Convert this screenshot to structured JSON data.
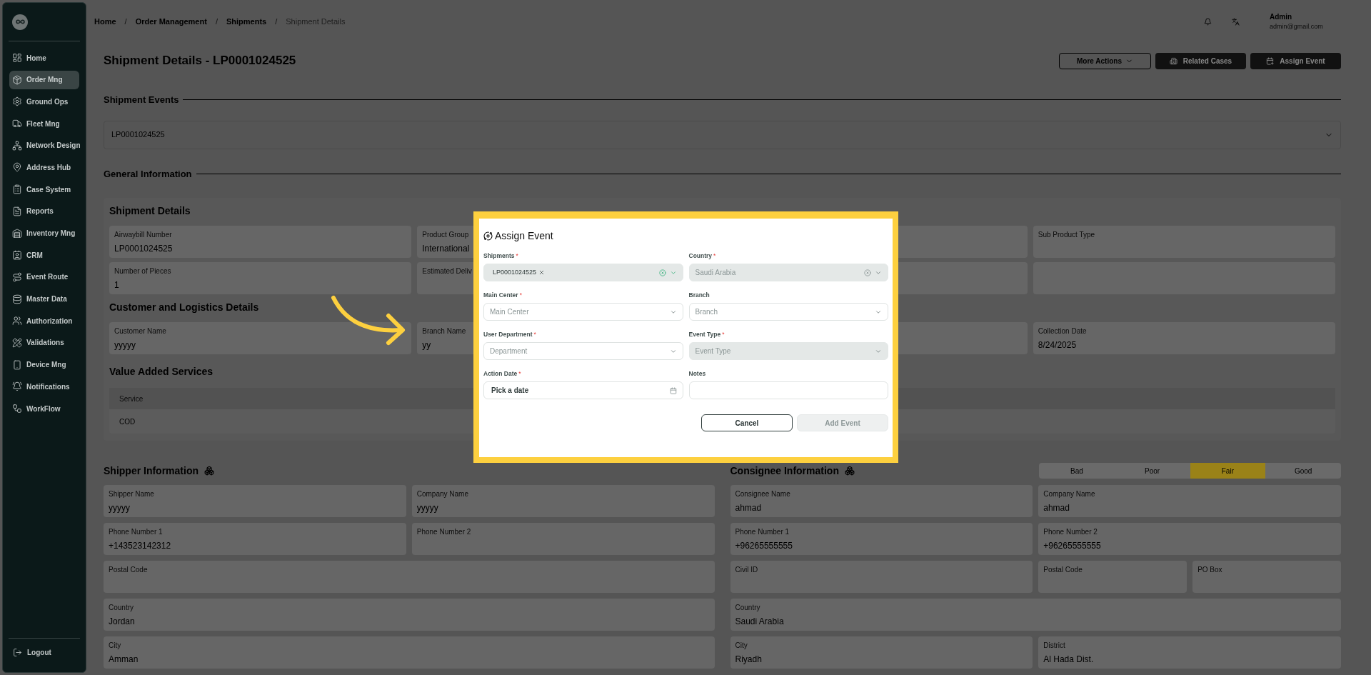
{
  "sidebar": {
    "items": [
      {
        "label": "Home",
        "selected": false
      },
      {
        "label": "Order Mng",
        "selected": true
      },
      {
        "label": "Ground Ops",
        "selected": false
      },
      {
        "label": "Fleet Mng",
        "selected": false
      },
      {
        "label": "Network Design",
        "selected": false
      },
      {
        "label": "Address Hub",
        "selected": false
      },
      {
        "label": "Case System",
        "selected": false
      },
      {
        "label": "Reports",
        "selected": false
      },
      {
        "label": "Inventory Mng",
        "selected": false
      },
      {
        "label": "CRM",
        "selected": false
      },
      {
        "label": "Event Route",
        "selected": false
      },
      {
        "label": "Master Data",
        "selected": false
      },
      {
        "label": "Authorization",
        "selected": false
      },
      {
        "label": "Validations",
        "selected": false
      },
      {
        "label": "Device Mng",
        "selected": false
      },
      {
        "label": "Notifications",
        "selected": false
      },
      {
        "label": "WorkFlow",
        "selected": false
      }
    ],
    "logout": "Logout"
  },
  "breadcrumb": {
    "separator": "/",
    "items": [
      {
        "label": "Home",
        "current": false
      },
      {
        "label": "Order Management",
        "current": false
      },
      {
        "label": "Shipments",
        "current": false
      },
      {
        "label": "Shipment Details",
        "current": true
      }
    ]
  },
  "user": {
    "name": "Admin",
    "email": "admin@gmail.com"
  },
  "page_title": "Shipment Details - LP0001024525",
  "actions": [
    {
      "label": "More Actions",
      "kind": "dropdown"
    },
    {
      "label": "Related Cases",
      "kind": "cases"
    },
    {
      "label": "Assign Event",
      "kind": "event"
    }
  ],
  "shipment_events": {
    "title": "Shipment Events",
    "value": "LP0001024525"
  },
  "general_information": {
    "title": "General Information",
    "sections": [
      {
        "title": "Shipment Details",
        "rows": [
          [
            {
              "label": "Airwaybill Number",
              "value": "LP0001024525"
            },
            {
              "label": "Product Group",
              "value": "International"
            },
            {},
            {
              "label": "Sub Product Type"
            }
          ],
          [
            {
              "label": "Number of Pieces",
              "value": "1"
            },
            {
              "label": "Estimated Deliv"
            },
            {},
            {}
          ]
        ]
      },
      {
        "title": "Customer and Logistics Details",
        "rows": [
          [
            {
              "label": "Customer Name",
              "value": "yyyyy"
            },
            {
              "label": "Branch Name",
              "value": "yy"
            },
            {},
            {
              "label": "Collection Date",
              "value": "8/24/2025"
            }
          ]
        ]
      }
    ],
    "services": {
      "title": "Value Added Services",
      "column": "Service",
      "rows": [
        "COD"
      ]
    }
  },
  "shipper": {
    "title": "Shipper Information",
    "rows": [
      [
        {
          "label": "Shipper Name",
          "value": "yyyyy"
        },
        {
          "label": "Company Name",
          "value": "yyyyy"
        }
      ],
      [
        {
          "label": "Phone Number 1",
          "value": "+143523142312"
        },
        {
          "label": "Phone Number 2"
        }
      ],
      [
        {
          "label": "Postal Code"
        }
      ],
      [
        {
          "label": "Country",
          "value": "Jordan"
        }
      ],
      [
        {
          "label": "City",
          "value": "Amman"
        }
      ]
    ]
  },
  "consignee": {
    "title": "Consignee Information",
    "rating": [
      {
        "label": "Bad",
        "selected": false
      },
      {
        "label": "Poor",
        "selected": false
      },
      {
        "label": "Fair",
        "selected": true
      },
      {
        "label": "Good",
        "selected": false
      }
    ],
    "rows": [
      [
        {
          "label": "Consignee Name",
          "value": "ahmad"
        },
        {
          "label": "Company Name",
          "value": "ahmad"
        }
      ],
      [
        {
          "label": "Phone Number 1",
          "value": "+96265555555"
        },
        {
          "label": "Phone Number 2",
          "value": "+96265555555"
        }
      ],
      [
        {
          "label": "Civil ID"
        },
        {
          "label": "Postal Code"
        },
        {
          "label": "PO Box"
        }
      ],
      [
        {
          "label": "Country",
          "value": "Saudi Arabia"
        }
      ],
      [
        {
          "label": "City",
          "value": "Riyadh"
        },
        {
          "label": "District",
          "value": "Al Hada Dist."
        }
      ]
    ]
  },
  "dialog": {
    "title": "Assign Event",
    "required_mark": "*",
    "fields": [
      {
        "label": "Shipments",
        "required": true,
        "kind": "multiselect",
        "chips": [
          "LP0001024525"
        ],
        "clearable": true,
        "disabled": false
      },
      {
        "label": "Country",
        "required": true,
        "kind": "select",
        "value": "Saudi Arabia",
        "clearable": true,
        "disabled": true
      },
      {
        "label": "Main Center",
        "required": true,
        "kind": "select",
        "placeholder": "Main Center",
        "disabled": false
      },
      {
        "label": "Branch",
        "required": false,
        "kind": "select",
        "placeholder": "Branch",
        "disabled": false
      },
      {
        "label": "User Department",
        "required": true,
        "kind": "select",
        "placeholder": "Department",
        "disabled": false
      },
      {
        "label": "Event Type",
        "required": true,
        "kind": "select",
        "placeholder": "Event Type",
        "disabled": true
      },
      {
        "label": "Action Date",
        "required": true,
        "kind": "date",
        "placeholder": "Pick a date",
        "disabled": false
      },
      {
        "label": "Notes",
        "required": false,
        "kind": "text",
        "disabled": false
      }
    ],
    "buttons": [
      {
        "label": "Cancel",
        "kind": "secondary",
        "disabled": false
      },
      {
        "label": "Add Event",
        "kind": "primary",
        "disabled": true
      }
    ]
  }
}
